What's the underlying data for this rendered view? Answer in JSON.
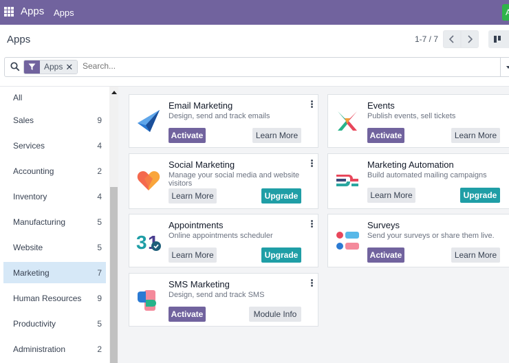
{
  "navbar": {
    "brand": "Apps",
    "menu": "Apps",
    "avatar_letter": "A",
    "bg_color": "#71639e"
  },
  "control_panel": {
    "breadcrumb": "Apps",
    "pager_value": "1-7 / 7"
  },
  "search": {
    "facet_label": "Apps",
    "facet_remove": "✕",
    "placeholder": "Search..."
  },
  "sidebar": {
    "items": [
      {
        "label": "All",
        "count": ""
      },
      {
        "label": "Sales",
        "count": "9"
      },
      {
        "label": "Services",
        "count": "4"
      },
      {
        "label": "Accounting",
        "count": "2"
      },
      {
        "label": "Inventory",
        "count": "4"
      },
      {
        "label": "Manufacturing",
        "count": "5"
      },
      {
        "label": "Website",
        "count": "5"
      },
      {
        "label": "Marketing",
        "count": "7"
      },
      {
        "label": "Human Resources",
        "count": "9"
      },
      {
        "label": "Productivity",
        "count": "5"
      },
      {
        "label": "Administration",
        "count": "2"
      }
    ],
    "active_index": 7
  },
  "apps": [
    {
      "title": "Email Marketing",
      "desc": "Design, send and track emails",
      "primary": "Activate",
      "secondary": "Learn More",
      "icon": "email-marketing-icon"
    },
    {
      "title": "Events",
      "desc": "Publish events, sell tickets",
      "primary": "Activate",
      "secondary": "Learn More",
      "icon": "events-icon"
    },
    {
      "title": "Social Marketing",
      "desc": "Manage your social media and website visitors",
      "primary": "Upgrade",
      "secondary": "Learn More",
      "icon": "social-marketing-icon"
    },
    {
      "title": "Marketing Automation",
      "desc": "Build automated mailing campaigns",
      "primary": "Upgrade",
      "secondary": "Learn More",
      "icon": "marketing-automation-icon"
    },
    {
      "title": "Appointments",
      "desc": "Online appointments scheduler",
      "primary": "Upgrade",
      "secondary": "Learn More",
      "icon": "appointments-icon"
    },
    {
      "title": "Surveys",
      "desc": "Send your surveys or share them live.",
      "primary": "Activate",
      "secondary": "Learn More",
      "icon": "surveys-icon"
    },
    {
      "title": "SMS Marketing",
      "desc": "Design, send and track SMS",
      "primary": "Activate",
      "secondary": "Module Info",
      "icon": "sms-marketing-icon"
    }
  ],
  "colors": {
    "primary": "#71639e",
    "upgrade": "#1f9ea6",
    "active_filter": "#d6e8f7"
  }
}
